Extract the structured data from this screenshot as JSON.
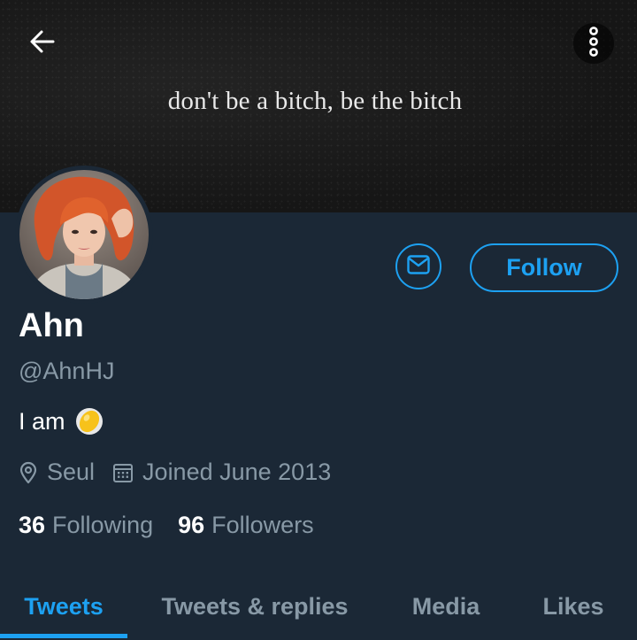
{
  "banner": {
    "quote": "don't be a bitch, be the bitch",
    "back_icon": "arrow-left-icon",
    "more_icon": "more-vertical-icon"
  },
  "profile": {
    "display_name": "Ahn",
    "handle": "@AhnHJ",
    "bio": "I am",
    "bio_emoji": "lemon-emoji",
    "location": "Seul",
    "location_icon": "location-pin-icon",
    "joined": "Joined June 2013",
    "joined_icon": "calendar-icon"
  },
  "actions": {
    "message_icon": "envelope-icon",
    "follow_label": "Follow"
  },
  "stats": {
    "following_count": "36",
    "following_label": "Following",
    "followers_count": "96",
    "followers_label": "Followers"
  },
  "tabs": [
    {
      "label": "Tweets",
      "active": true
    },
    {
      "label": "Tweets & replies",
      "active": false
    },
    {
      "label": "Media",
      "active": false
    },
    {
      "label": "Likes",
      "active": false
    }
  ],
  "colors": {
    "background": "#1b2836",
    "accent": "#1da1f2",
    "secondary_text": "#8899a6",
    "primary_text": "#ffffff"
  }
}
